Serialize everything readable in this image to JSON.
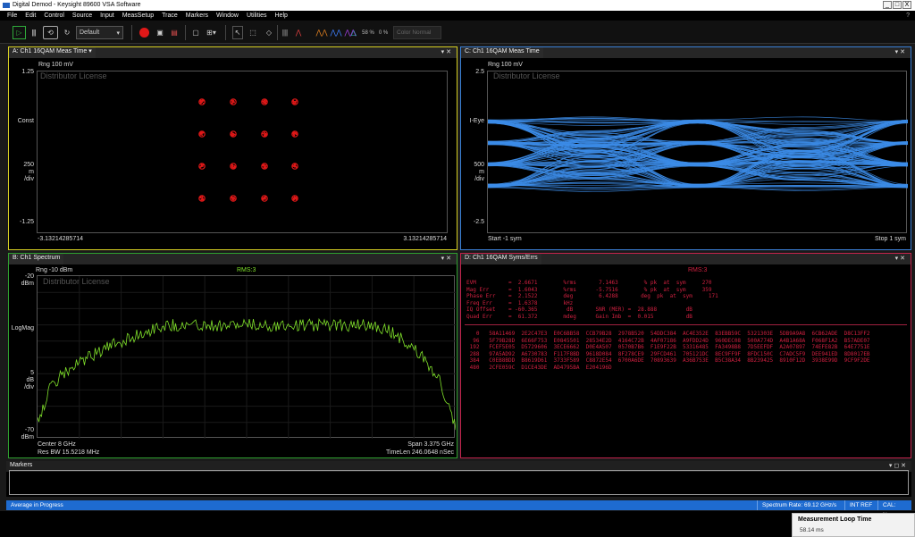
{
  "window": {
    "title": "Digital Demod - Keysight 89600 VSA Software",
    "controls": [
      "_",
      "□",
      "X"
    ]
  },
  "menu": [
    "File",
    "Edit",
    "Control",
    "Source",
    "Input",
    "MeasSetup",
    "Trace",
    "Markers",
    "Window",
    "Utilities",
    "Help"
  ],
  "menu_help_glyph": "?",
  "toolbar": {
    "preset_label": "Default",
    "pct1": "58 %",
    "pct2": "0 %",
    "color_mode": "Color Normal",
    "icons": [
      "play-icon",
      "pause-icon",
      "restart-icon",
      "record-icon",
      "camera-icon",
      "recall-icon",
      "marker-select-icon",
      "grid-icon",
      "pointer-icon",
      "zoom-icon",
      "diamond-icon",
      "bars-icon",
      "marker-peak-icon",
      "spectrum-icon",
      "triangle-icon"
    ]
  },
  "panels": {
    "a": {
      "tab": "A: Ch1 16QAM Meas Time",
      "range": "Rng 100 mV",
      "watermark": "Distributor License",
      "y_top": "1.25",
      "y_mid": "Const",
      "y_scale": [
        "250",
        "m",
        "/div"
      ],
      "y_bottom": "-1.25",
      "x_left": "-3.13214285714",
      "x_right": "3.13214285714"
    },
    "c": {
      "tab": "C: Ch1 16QAM Meas Time",
      "range": "Rng 100 mV",
      "watermark": "Distributor License",
      "y_top": "2.5",
      "y_mid": "I-Eye",
      "y_scale": [
        "500",
        "m",
        "/div"
      ],
      "y_bottom": "-2.5",
      "x_left": "Start -1  sym",
      "x_right": "Stop 1  sym"
    },
    "b": {
      "tab": "B: Ch1 Spectrum",
      "range": "Rng -10 dBm",
      "rms": "RMS:3",
      "watermark": "Distributor License",
      "y_top": [
        "-20",
        "dBm"
      ],
      "y_mid": "LogMag",
      "y_scale": [
        "5",
        "dB",
        "/div"
      ],
      "y_bottom": [
        "-70",
        "dBm"
      ],
      "center": "Center 8 GHz",
      "span": "Span 3.375 GHz",
      "rbw": "Res BW 15.5218 MHz",
      "timelen": "TimeLen 246.0648 nSec"
    },
    "d": {
      "tab": "D: Ch1 16QAM Syms/Errs",
      "rms": "RMS:3",
      "metrics": [
        "EVM          =  2.6671        %rms       7.1463        % pk  at  sym     270",
        "Mag Err      =  1.6043        %rms      -5.7516        % pk  at  sym     359",
        "Phase Err    =  2.1522        deg        6.4288       deg  pk  at  sym     171",
        "Freq Err     =  1.6378        kHz",
        "IQ Offset    = -60.365         dB       SNR (MER) =  28.888         dB",
        "Quad Err     =  61.372        mdeg      Gain Imb  =  0.015          dB"
      ],
      "symbols": [
        "   0   58A11469  2E2C47E3  E0C6BB58  CCB79B28  2978B520  54DDC384  AC4E352E  83EBB59C  5321303E  5DB9A9A8  6CB62ADE  D8C13FF2",
        "  96   5F79B28D  6E66F753  E0845501  28534E2D  4164C72B  4AF07186  A9FDD24D  960DEC08  500A774D  A4B1A68A  F068F1A2  B57ADE07",
        " 192   FCEF5E05  D5729606  3ECE6662  D0E4A507  0570B7B6  F1E9F22B  53316485  FA3498B8  7D5EEFDF  A2A07897  74EFE82B  64E7751E",
        " 288   97A5AD92  A6730783  F117F8BD  9618D084  8F278CE9  29FCD461  705121DC  8EC9FF9F  8FDC150C  C7ADC5F9  DEE941ED  8D8017EB",
        " 384   C0EB8BDD  B8619D61  3733F589  C8872E54  6700A6DE  70893639  A36B753E  B5C38A34  8B239425  8910F12D  3938E99D  9CF9F2DE",
        " 480   2CFE059C  D1CE43DE  AD4795BA  E204196D"
      ]
    }
  },
  "markers_panel": {
    "title": "Markers"
  },
  "status": {
    "left": "Average in Progress",
    "sample_rate": "Spectrum Rate: 69.12 GHz/s",
    "ref": "INT REF",
    "cal": "CAL: None"
  },
  "tooltip": {
    "title": "Measurement Loop Time",
    "value": "58.14 ms"
  },
  "colors": {
    "yellow": "#d6cf22",
    "blue": "#3a7fd5",
    "green": "#2fa02f",
    "red": "#c2234c",
    "trace_green": "#7fe02a",
    "eye_blue": "#3c8ce8",
    "const_red": "#e01818",
    "status_blue": "#1e6bd0"
  }
}
